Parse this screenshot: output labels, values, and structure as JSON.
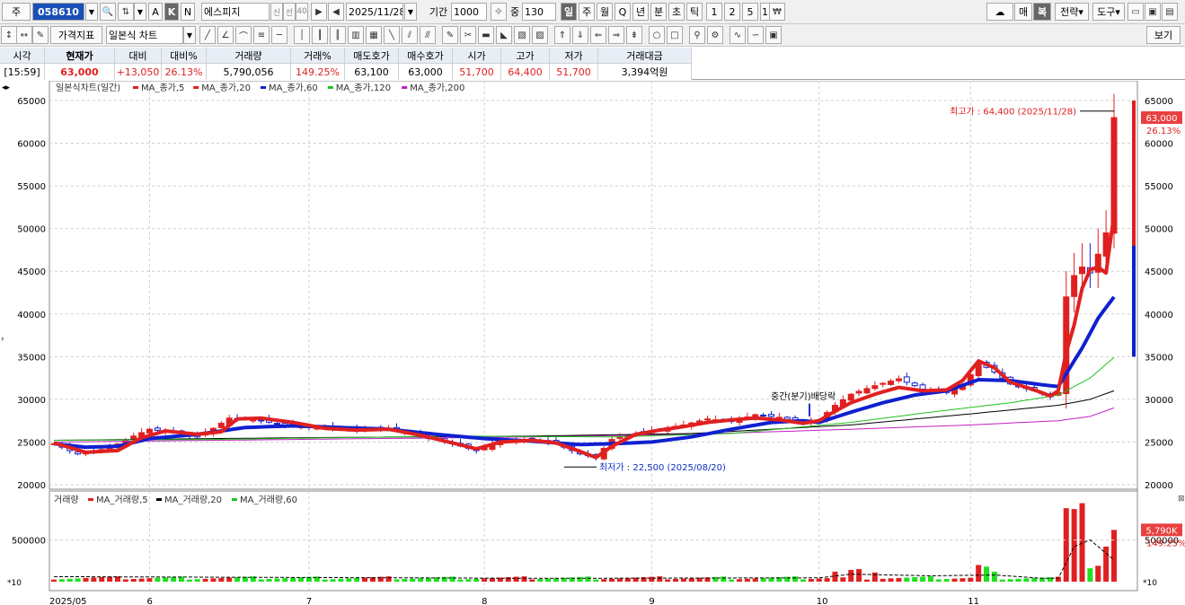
{
  "toolbar1": {
    "market_label": "주",
    "code": "058610",
    "stock_name": "에스피지",
    "btn_a": "A",
    "btn_k": "K",
    "btn_n": "N",
    "btn_sin": "신",
    "btn_sel": "선",
    "btn_40": "40",
    "date": "2025/11/28",
    "period_label": "기간",
    "period_value": "1000",
    "count_label": "중",
    "count_value": "130",
    "intervals": [
      "일",
      "주",
      "월",
      "Q",
      "년",
      "분",
      "초",
      "틱",
      "1",
      "2",
      "5",
      "15"
    ],
    "active_interval": "일",
    "won_icon": "₩",
    "buy_label": "매",
    "sell_label": "복",
    "strategy_label": "전략",
    "tools_label": "도구"
  },
  "toolbar2": {
    "indicator_btn": "가격지표",
    "chart_type": "일본식 차트",
    "view_btn": "보기"
  },
  "quote": {
    "headers": [
      "시각",
      "현재가",
      "대비",
      "대비%",
      "거래량",
      "거래%",
      "매도호가",
      "매수호가",
      "시가",
      "고가",
      "저가",
      "거래대금"
    ],
    "values": [
      "[15:59]",
      "63,000",
      "+13,050",
      "26.13%",
      "5,790,056",
      "149.25%",
      "63,100",
      "63,000",
      "51,700",
      "64,400",
      "51,700",
      "3,394억원"
    ]
  },
  "chart_data": {
    "type": "candlestick",
    "title": "일본식차트(일간)",
    "legend": [
      {
        "name": "MA_종가,5",
        "color": "#e02020"
      },
      {
        "name": "MA_종가,20",
        "color": "#e02020"
      },
      {
        "name": "MA_종가,60",
        "color": "#1020d0"
      },
      {
        "name": "MA_종가,120",
        "color": "#20c020"
      },
      {
        "name": "MA_종가,200",
        "color": "#c020c0"
      }
    ],
    "ylim": [
      20000,
      65000
    ],
    "yticks": [
      20000,
      25000,
      30000,
      35000,
      40000,
      45000,
      50000,
      55000,
      60000,
      65000
    ],
    "x_labels": [
      "2025/05",
      "6",
      "7",
      "8",
      "9",
      "10",
      "11"
    ],
    "x_label_days": [
      0,
      12,
      32,
      54,
      75,
      96,
      115
    ],
    "annotations": {
      "high": "최고가 : 64,400 (2025/11/28)",
      "low": "최저가 : 22,500 (2025/08/20)",
      "event": "중간(분기)배당락"
    },
    "last_price_tag": "63,000",
    "last_change_tag": "26.13%",
    "anchors_close": [
      [
        0,
        24800
      ],
      [
        3,
        23600
      ],
      [
        7,
        24300
      ],
      [
        10,
        25700
      ],
      [
        12,
        26500
      ],
      [
        16,
        26000
      ],
      [
        18,
        25600
      ],
      [
        20,
        26600
      ],
      [
        22,
        27800
      ],
      [
        26,
        27500
      ],
      [
        30,
        26800
      ],
      [
        34,
        26700
      ],
      [
        38,
        26400
      ],
      [
        42,
        26600
      ],
      [
        46,
        25700
      ],
      [
        50,
        24800
      ],
      [
        53,
        24000
      ],
      [
        56,
        25100
      ],
      [
        60,
        25300
      ],
      [
        63,
        24800
      ],
      [
        66,
        23600
      ],
      [
        68,
        23200
      ],
      [
        70,
        25300
      ],
      [
        73,
        26000
      ],
      [
        76,
        26500
      ],
      [
        79,
        27000
      ],
      [
        82,
        27700
      ],
      [
        85,
        27400
      ],
      [
        88,
        28200
      ],
      [
        91,
        27900
      ],
      [
        94,
        27200
      ],
      [
        96,
        27600
      ],
      [
        98,
        29300
      ],
      [
        100,
        30600
      ],
      [
        103,
        31600
      ],
      [
        106,
        32400
      ],
      [
        109,
        31200
      ],
      [
        112,
        30800
      ],
      [
        114,
        31500
      ],
      [
        116,
        34300
      ],
      [
        118,
        33200
      ],
      [
        120,
        31800
      ],
      [
        123,
        31000
      ],
      [
        125,
        30300
      ],
      [
        126,
        30800
      ],
      [
        127,
        42000
      ],
      [
        128,
        44500
      ],
      [
        129,
        45500
      ],
      [
        130,
        44800
      ],
      [
        131,
        47000
      ],
      [
        132,
        49500
      ],
      [
        133,
        63000
      ]
    ],
    "ma_close_5_anchors": [
      [
        0,
        24900
      ],
      [
        4,
        23800
      ],
      [
        8,
        24000
      ],
      [
        11,
        25500
      ],
      [
        14,
        26300
      ],
      [
        18,
        25900
      ],
      [
        21,
        26200
      ],
      [
        23,
        27700
      ],
      [
        26,
        27800
      ],
      [
        30,
        27300
      ],
      [
        34,
        26600
      ],
      [
        38,
        26400
      ],
      [
        42,
        26500
      ],
      [
        46,
        25800
      ],
      [
        50,
        24900
      ],
      [
        53,
        24200
      ],
      [
        56,
        25000
      ],
      [
        60,
        25200
      ],
      [
        63,
        24900
      ],
      [
        66,
        23900
      ],
      [
        68,
        23200
      ],
      [
        70,
        24500
      ],
      [
        73,
        25900
      ],
      [
        76,
        26400
      ],
      [
        79,
        26800
      ],
      [
        82,
        27300
      ],
      [
        85,
        27600
      ],
      [
        88,
        27800
      ],
      [
        91,
        27600
      ],
      [
        94,
        27200
      ],
      [
        96,
        27500
      ],
      [
        98,
        28600
      ],
      [
        100,
        29600
      ],
      [
        103,
        30600
      ],
      [
        106,
        31400
      ],
      [
        109,
        31000
      ],
      [
        112,
        31100
      ],
      [
        114,
        32200
      ],
      [
        116,
        34500
      ],
      [
        118,
        33700
      ],
      [
        120,
        32000
      ],
      [
        123,
        31100
      ],
      [
        125,
        30400
      ],
      [
        126,
        31000
      ],
      [
        127,
        35500
      ],
      [
        128,
        38700
      ],
      [
        129,
        43000
      ],
      [
        130,
        45200
      ],
      [
        131,
        45500
      ],
      [
        132,
        44800
      ],
      [
        133,
        51600
      ]
    ],
    "ma_close_20_anchors": [
      [
        0,
        24800
      ],
      [
        4,
        24400
      ],
      [
        8,
        24500
      ],
      [
        12,
        25400
      ],
      [
        18,
        25900
      ],
      [
        24,
        26700
      ],
      [
        30,
        26900
      ],
      [
        36,
        26700
      ],
      [
        42,
        26500
      ],
      [
        48,
        25900
      ],
      [
        54,
        25400
      ],
      [
        60,
        25100
      ],
      [
        66,
        24700
      ],
      [
        70,
        24800
      ],
      [
        75,
        25000
      ],
      [
        80,
        25600
      ],
      [
        85,
        26500
      ],
      [
        90,
        27300
      ],
      [
        94,
        27500
      ],
      [
        96,
        27300
      ],
      [
        100,
        28500
      ],
      [
        104,
        29600
      ],
      [
        108,
        30500
      ],
      [
        112,
        31000
      ],
      [
        116,
        32300
      ],
      [
        120,
        32200
      ],
      [
        124,
        31700
      ],
      [
        126,
        31500
      ],
      [
        127,
        33000
      ],
      [
        129,
        36000
      ],
      [
        131,
        39500
      ],
      [
        133,
        42000
      ]
    ],
    "ma_close_120_anchors": [
      [
        0,
        25200
      ],
      [
        20,
        25300
      ],
      [
        50,
        25700
      ],
      [
        70,
        25600
      ],
      [
        85,
        26000
      ],
      [
        100,
        27300
      ],
      [
        110,
        28500
      ],
      [
        120,
        29600
      ],
      [
        126,
        30500
      ],
      [
        130,
        32500
      ],
      [
        133,
        34900
      ]
    ],
    "ma_close_200_anchors": [
      [
        0,
        25000
      ],
      [
        30,
        25300
      ],
      [
        60,
        25600
      ],
      [
        80,
        25900
      ],
      [
        100,
        26500
      ],
      [
        115,
        27000
      ],
      [
        126,
        27500
      ],
      [
        130,
        28000
      ],
      [
        133,
        29000
      ]
    ],
    "ma_black_anchors": [
      [
        0,
        25200
      ],
      [
        30,
        25500
      ],
      [
        60,
        25700
      ],
      [
        80,
        26000
      ],
      [
        100,
        27000
      ],
      [
        115,
        28300
      ],
      [
        126,
        29300
      ],
      [
        130,
        30000
      ],
      [
        133,
        31000
      ]
    ],
    "volume_panel": {
      "title": "거래량",
      "legend": [
        {
          "name": "MA_거래량,5",
          "color": "#e02020"
        },
        {
          "name": "MA_거래량,20",
          "color": "#000000"
        },
        {
          "name": "MA_거래량,60",
          "color": "#20c020"
        }
      ],
      "ytick": "500000",
      "ytick_value": 500000,
      "ymax": 1000000,
      "multiplier_label": "*10",
      "last_volume_tag": "5,790K",
      "last_volume_pct": "149.25%",
      "big_bars": [
        [
          127,
          880000
        ],
        [
          128,
          870000
        ],
        [
          129,
          940000
        ],
        [
          130,
          160000
        ],
        [
          131,
          190000
        ],
        [
          132,
          420000
        ],
        [
          133,
          620000
        ]
      ],
      "medium_bars": [
        [
          98,
          120000
        ],
        [
          100,
          140000
        ],
        [
          101,
          150000
        ],
        [
          103,
          110000
        ],
        [
          116,
          200000
        ],
        [
          117,
          180000
        ],
        [
          118,
          120000
        ]
      ]
    }
  }
}
